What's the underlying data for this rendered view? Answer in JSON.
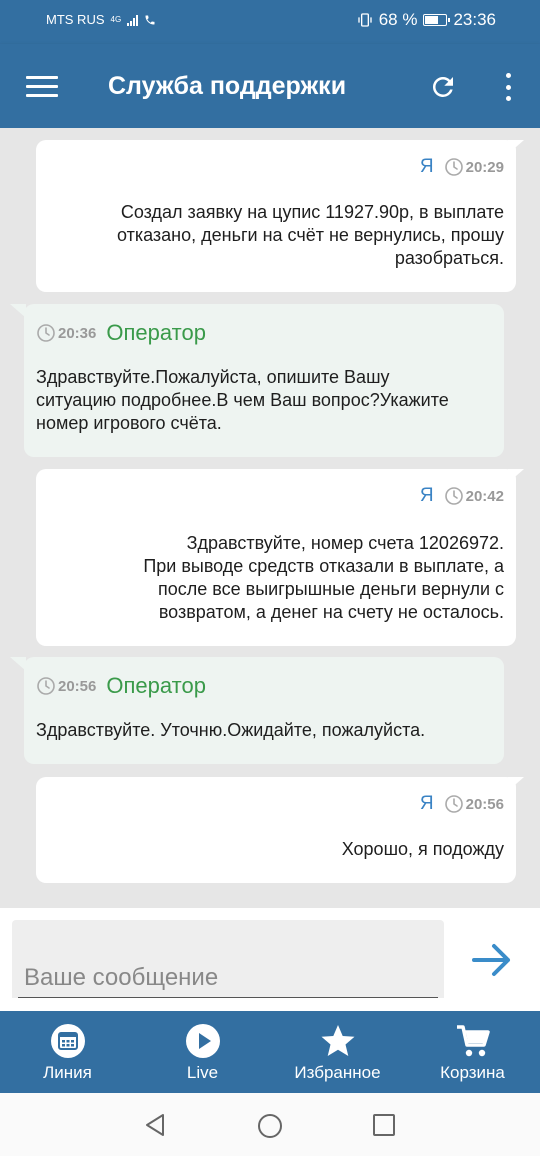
{
  "status_bar": {
    "carrier": "MTS RUS",
    "network": "4G",
    "battery_percent": "68 %",
    "battery_level": 0.68,
    "time": "23:36"
  },
  "app_bar": {
    "title": "Служба поддержки",
    "icons": [
      "menu-icon",
      "refresh-icon",
      "more-vertical-icon"
    ]
  },
  "messages": [
    {
      "from": "me",
      "sender": "Я",
      "time": "20:29",
      "lines": [
        "Создал заявку на цупис 11927.90р, в выплате",
        "отказано, деньги на счёт не вернулись, прошу",
        "разобраться."
      ]
    },
    {
      "from": "operator",
      "sender": "Оператор",
      "time": "20:36",
      "lines": [
        "Здравствуйте.Пожалуйста, опишите Вашу",
        "ситуацию подробнее.В чем Ваш вопрос?Укажите",
        "номер игрового счёта."
      ]
    },
    {
      "from": "me",
      "sender": "Я",
      "time": "20:42",
      "lines": [
        "Здравствуйте, номер счета 12026972.",
        "При выводе средств отказали в выплате, а",
        "после все выигрышные деньги вернули с",
        "возвратом, а денег на счету не осталось."
      ]
    },
    {
      "from": "operator",
      "sender": "Оператор",
      "time": "20:56",
      "lines": [
        "Здравствуйте. Уточню.Ожидайте, пожалуйста."
      ]
    },
    {
      "from": "me",
      "sender": "Я",
      "time": "20:56",
      "lines": [
        "Хорошо, я подожду"
      ]
    }
  ],
  "compose": {
    "placeholder": "Ваше сообщение",
    "send_icon": "arrow-right-icon"
  },
  "bottom_nav": [
    {
      "label": "Линия",
      "icon": "calendar-icon"
    },
    {
      "label": "Live",
      "icon": "play-icon"
    },
    {
      "label": "Избранное",
      "icon": "star-icon"
    },
    {
      "label": "Корзина",
      "icon": "cart-icon"
    }
  ],
  "colors": {
    "primary": "#336fa1",
    "operator_name": "#3a9a4a",
    "me_name": "#3a83c4",
    "send_arrow": "#3a8cc9"
  }
}
